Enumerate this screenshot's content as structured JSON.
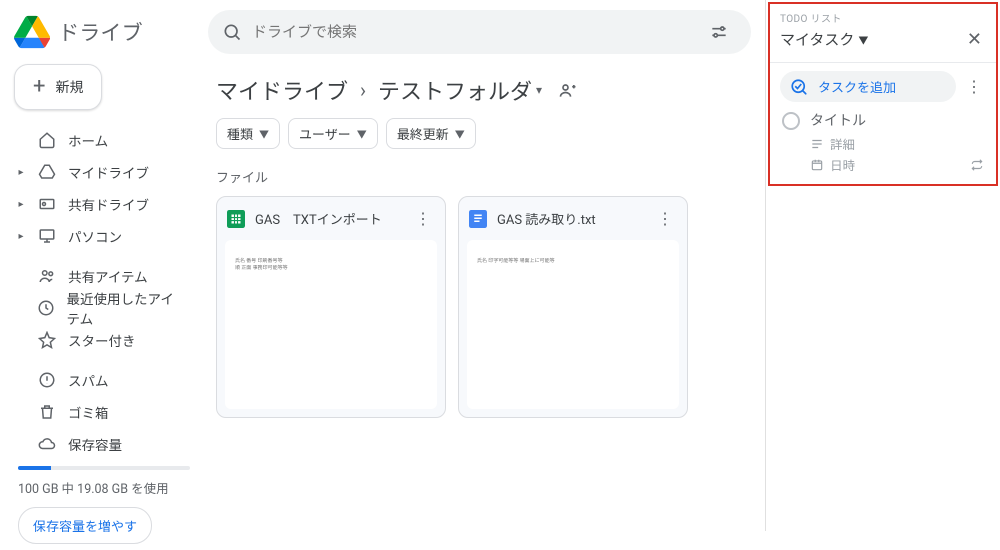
{
  "app": {
    "title": "ドライブ"
  },
  "new_button": {
    "label": "新規"
  },
  "nav": {
    "home": "ホーム",
    "mydrive": "マイドライブ",
    "shared_drives": "共有ドライブ",
    "computers": "パソコン",
    "shared": "共有アイテム",
    "recent": "最近使用したアイテム",
    "starred": "スター付き",
    "spam": "スパム",
    "trash": "ゴミ箱",
    "storage": "保存容量"
  },
  "storage": {
    "text": "100 GB 中 19.08 GB を使用",
    "buy": "保存容量を増やす"
  },
  "search": {
    "placeholder": "ドライブで検索"
  },
  "breadcrumb": {
    "root": "マイドライブ",
    "folder": "テストフォルダ"
  },
  "chips": {
    "type": "種類",
    "user": "ユーザー",
    "modified": "最終更新"
  },
  "section": {
    "files": "ファイル"
  },
  "files": [
    {
      "name": "GAS　TXTインポート",
      "type": "sheets"
    },
    {
      "name": "GAS 読み取り.txt",
      "type": "docs"
    }
  ],
  "tasks": {
    "small": "TODO リスト",
    "list_name": "マイタスク",
    "add_label": "タスクを追加",
    "item_title": "タイトル",
    "item_detail": "詳細",
    "item_date": "日時"
  }
}
